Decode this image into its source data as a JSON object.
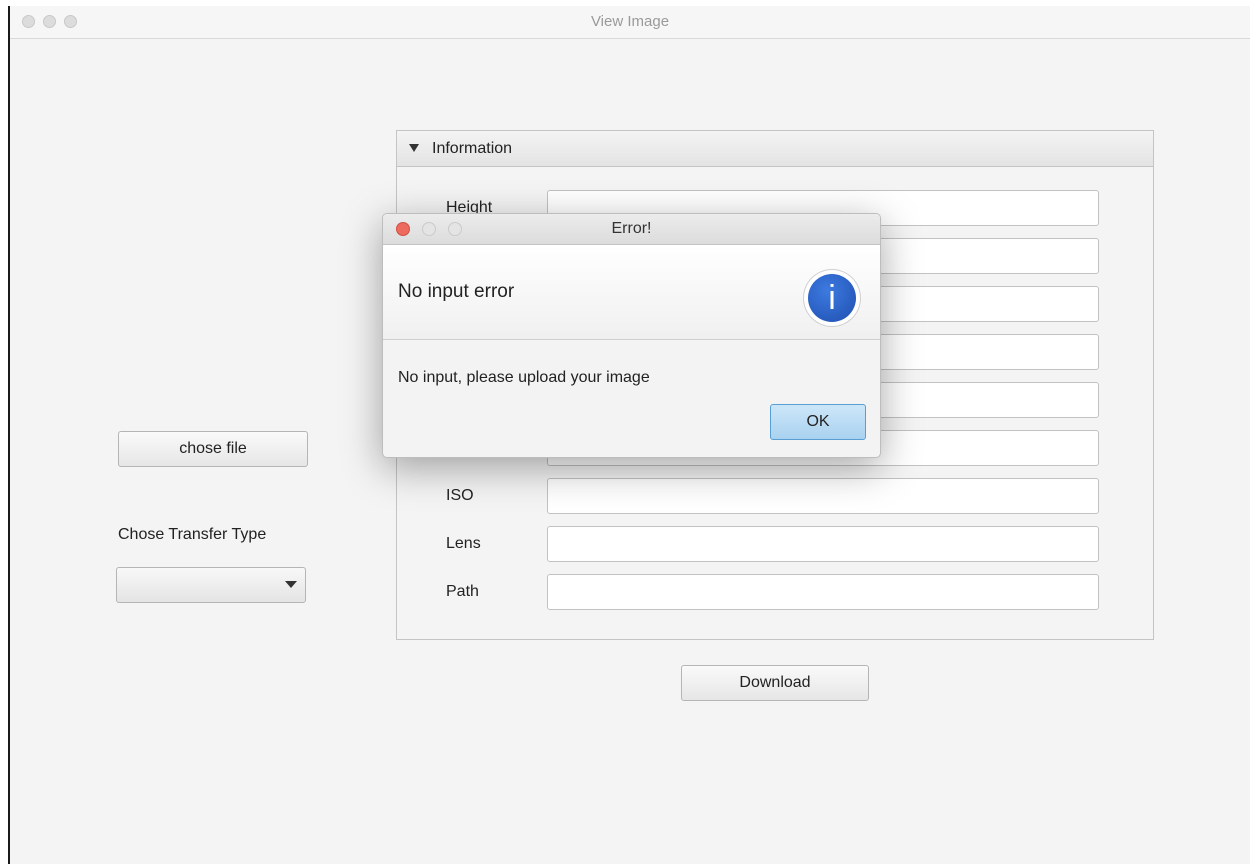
{
  "window": {
    "title": "View Image"
  },
  "left": {
    "chose_file_label": "chose file",
    "transfer_type_label": "Chose Transfer Type",
    "transfer_type_value": ""
  },
  "info_panel": {
    "title": "Information",
    "fields": [
      {
        "label": "Height",
        "value": ""
      },
      {
        "label": "",
        "value": ""
      },
      {
        "label": "",
        "value": ""
      },
      {
        "label": "",
        "value": ""
      },
      {
        "label": "",
        "value": ""
      },
      {
        "label": "",
        "value": ""
      },
      {
        "label": "ISO",
        "value": ""
      },
      {
        "label": "Lens",
        "value": ""
      },
      {
        "label": "Path",
        "value": ""
      }
    ]
  },
  "download_label": "Download",
  "dialog": {
    "title": "Error!",
    "header": "No input error",
    "icon": "info-icon",
    "content": "No input, please upload your image",
    "ok_label": "OK"
  },
  "colors": {
    "close_red": "#ec6a5e",
    "ok_blue": "#a9d2f0",
    "info_blue": "#2c63c8"
  }
}
